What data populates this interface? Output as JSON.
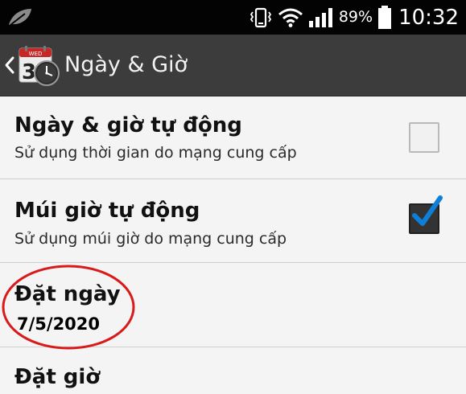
{
  "status_bar": {
    "battery_percent": "89%",
    "time": "10:32",
    "icons": [
      "leaf-icon",
      "vibrate-icon",
      "wifi-icon",
      "signal-icon",
      "battery-icon"
    ]
  },
  "action_bar": {
    "title": "Ngày & Giờ",
    "app_icon": "calendar-clock-icon",
    "calendar_label": "WED",
    "calendar_day": "3"
  },
  "settings": {
    "auto_datetime": {
      "title": "Ngày & giờ tự động",
      "summary": "Sử dụng thời gian do mạng cung cấp",
      "checked": false
    },
    "auto_timezone": {
      "title": "Múi giờ tự động",
      "summary": "Sử dụng múi giờ do mạng cung cấp",
      "checked": true
    },
    "set_date": {
      "title": "Đặt ngày",
      "value": "7/5/2020",
      "highlighted": true
    },
    "set_time": {
      "title": "Đặt giờ"
    }
  },
  "colors": {
    "status_bar_bg": "#030303",
    "action_bar_bg": "#3c3c3c",
    "list_bg": "#f4f4f4",
    "divider": "#cfcfcf",
    "checkmark": "#0e7fd8",
    "highlight_circle": "#d81a1a"
  }
}
